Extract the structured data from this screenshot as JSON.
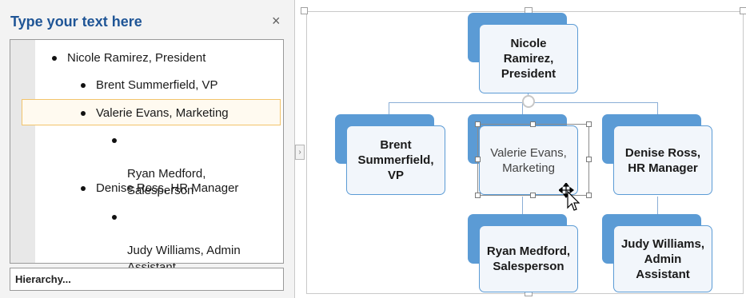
{
  "text_pane": {
    "title": "Type your text here",
    "close_glyph": "×",
    "items": [
      {
        "text": "Nicole Ramirez, President",
        "level": 1
      },
      {
        "text": "Brent Summerfield, VP",
        "level": 2
      },
      {
        "text": "Valerie Evans, Marketing",
        "level": 2,
        "selected": true
      },
      {
        "text": "Ryan Medford,\nSalesperson",
        "level": 3
      },
      {
        "text": "Denise Ross, HR Manager",
        "level": 2
      },
      {
        "text": "Judy Williams, Admin\nAssistant",
        "level": 3
      }
    ],
    "layout_name": "Hierarchy..."
  },
  "expander_glyph": "›",
  "org_chart": {
    "nodes": {
      "nicole": "Nicole\nRamirez,\nPresident",
      "brent": "Brent\nSummerfield,\nVP",
      "valerie": "Valerie Evans,\nMarketing",
      "denise": "Denise Ross,\nHR Manager",
      "ryan": "Ryan Medford,\nSalesperson",
      "judy": "Judy Williams,\nAdmin\nAssistant"
    },
    "selected_node": "valerie",
    "accent_color": "#5b9bd5",
    "fill_color": "#f2f6fb"
  },
  "icons": {
    "close": "close-icon",
    "expander": "chevron-right-icon",
    "rotate": "rotate-handle-icon",
    "cursor": "move-cursor-icon"
  }
}
